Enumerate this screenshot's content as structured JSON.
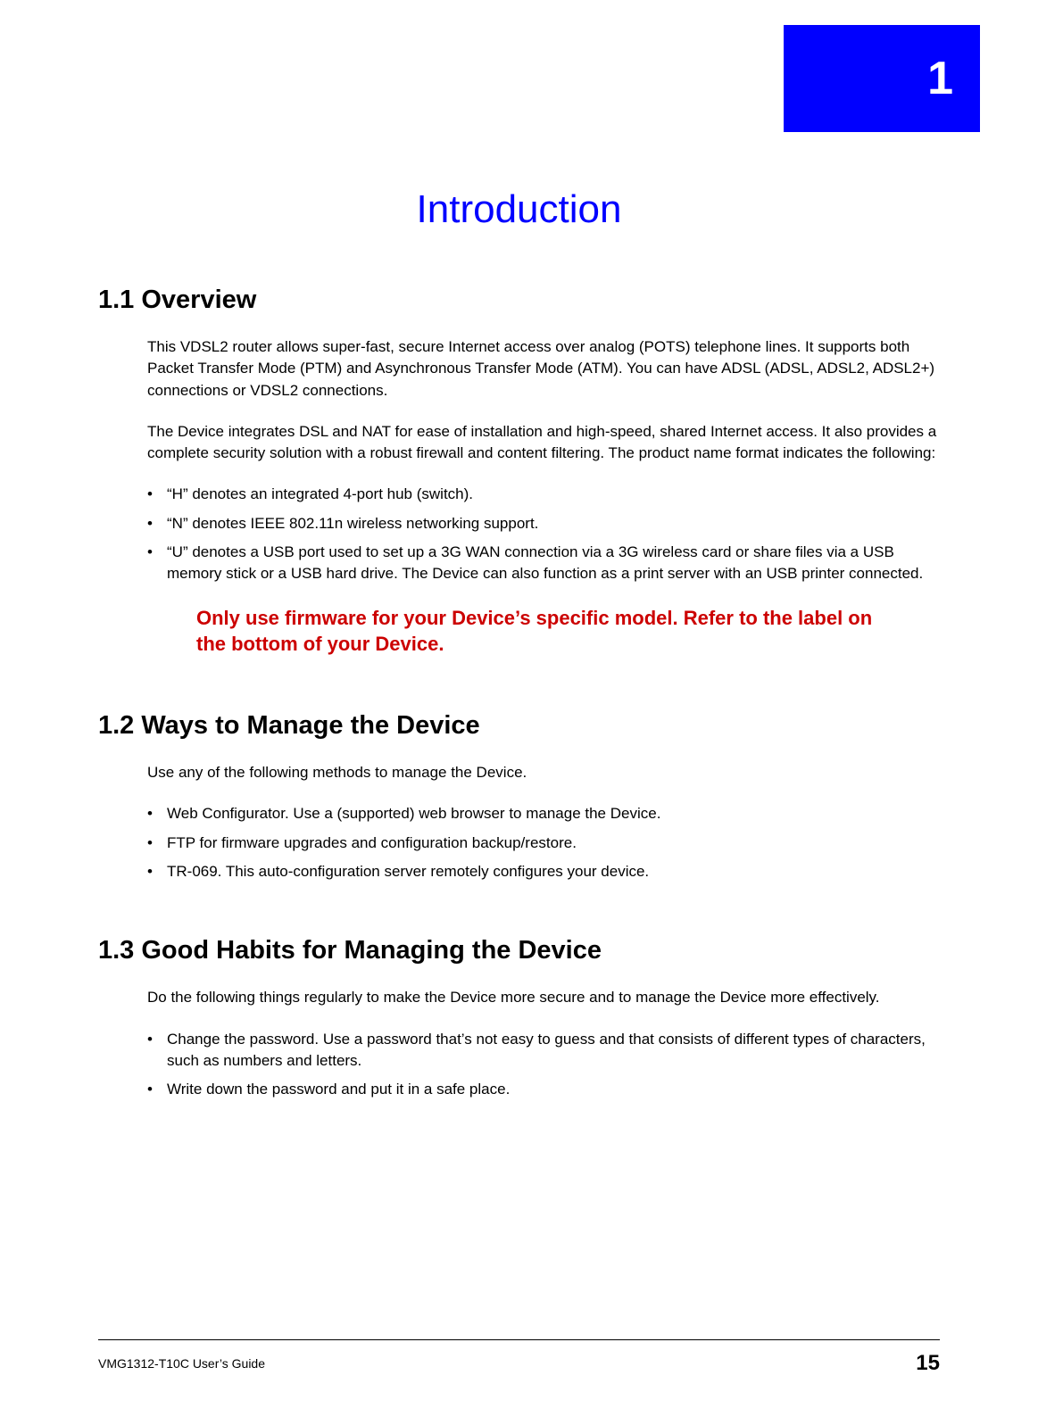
{
  "chapter": {
    "number": "1",
    "title": "Introduction"
  },
  "sections": {
    "s1": {
      "heading": "1.1  Overview",
      "para1": "This VDSL2 router allows super-fast, secure Internet access over analog (POTS) telephone lines. It supports both Packet Transfer Mode (PTM) and Asynchronous Transfer Mode (ATM). You can have ADSL (ADSL, ADSL2, ADSL2+) connections or VDSL2 connections.",
      "para2": "The Device integrates DSL and NAT for ease of installation and high-speed, shared Internet access. It also provides a complete security solution with a robust firewall and content filtering. The product name format indicates the following:",
      "bullets": {
        "b0": "“H” denotes an integrated 4-port hub (switch).",
        "b1": "“N” denotes IEEE 802.11n wireless networking support.",
        "b2": "“U” denotes a USB port used to set up a 3G WAN connection via a 3G wireless card or share files via a USB memory stick or a USB hard drive. The Device can also function as a print server with an USB printer connected."
      },
      "warning": "Only use firmware for your Device’s specific model. Refer to the label on the bottom of your Device."
    },
    "s2": {
      "heading": "1.2  Ways to Manage the Device",
      "para1": "Use any of the following methods to manage the Device.",
      "bullets": {
        "b0": "Web Configurator. Use a (supported) web browser to manage the Device.",
        "b1": "FTP for firmware upgrades and configuration backup/restore.",
        "b2": "TR-069. This auto-configuration server remotely configures your device."
      }
    },
    "s3": {
      "heading": "1.3  Good Habits for Managing the Device",
      "para1": "Do the following things regularly to make the Device more secure and to manage the Device more effectively.",
      "bullets": {
        "b0": "Change the password. Use a password that’s not easy to guess and that consists of different types of characters, such as numbers and letters.",
        "b1": "Write down the password and put it in a safe place."
      }
    }
  },
  "footer": {
    "left": "VMG1312-T10C User’s Guide",
    "right": "15"
  }
}
